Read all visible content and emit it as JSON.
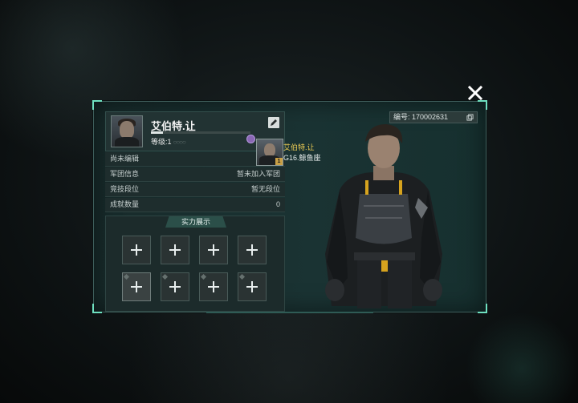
{
  "profile": {
    "name": "艾伯特.让",
    "level_label": "等级:1",
    "xp_fraction": 0.12,
    "id_label": "编号: 170002631"
  },
  "info_rows": [
    {
      "label": "尚未编辑",
      "value": ""
    },
    {
      "label": "军团信息",
      "value": "暂未加入军团"
    },
    {
      "label": "竞技段位",
      "value": "暂无段位"
    },
    {
      "label": "成就数量",
      "value": "0"
    }
  ],
  "showcase": {
    "title": "实力展示"
  },
  "character": {
    "name": "艾伯特.让",
    "subtitle": "G16.鲸鱼座",
    "badge": "1"
  },
  "colors": {
    "accent": "#6ee0c0",
    "name_highlight": "#f1cf55",
    "panel_bg": "#1a3333"
  },
  "icons": [
    "close-icon",
    "edit-icon",
    "copy-icon",
    "plus-icon",
    "purple-gem-icon"
  ]
}
